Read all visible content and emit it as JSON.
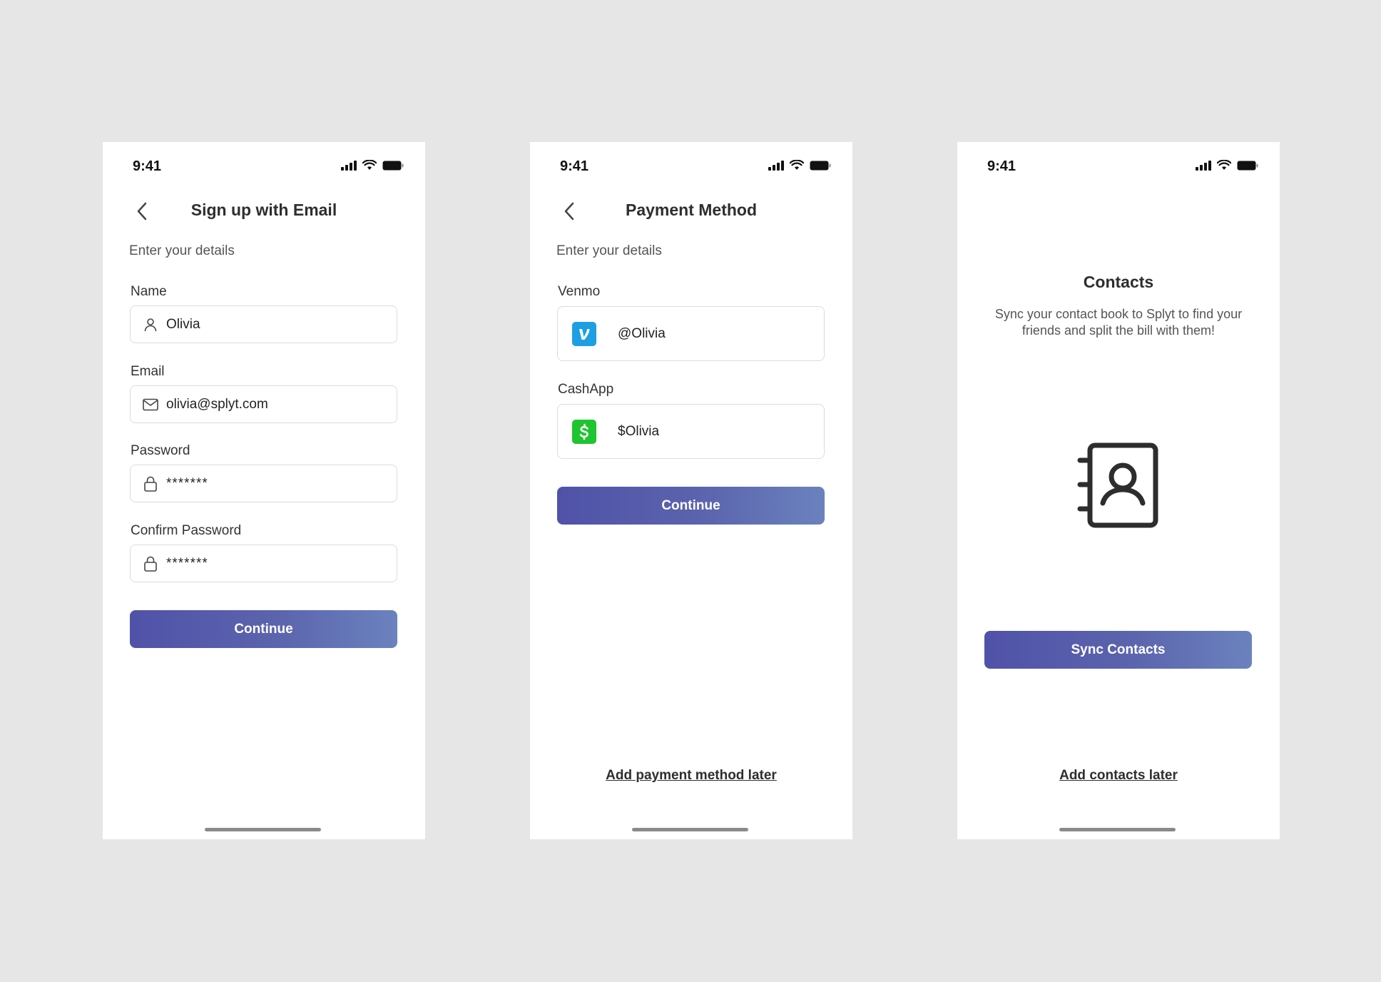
{
  "status_bar": {
    "time": "9:41"
  },
  "signup": {
    "title": "Sign up with Email",
    "subtitle": "Enter your details",
    "name_label": "Name",
    "name_value": "Olivia",
    "email_label": "Email",
    "email_value": "olivia@splyt.com",
    "password_label": "Password",
    "password_value": "*******",
    "confirm_label": "Confirm Password",
    "confirm_value": "*******",
    "continue_label": "Continue"
  },
  "payment": {
    "title": "Payment Method",
    "subtitle": "Enter your details",
    "venmo_label": "Venmo",
    "venmo_value": "@Olivia",
    "cashapp_label": "CashApp",
    "cashapp_value": "$Olivia",
    "continue_label": "Continue",
    "later_link": "Add payment method later"
  },
  "contacts": {
    "title": "Contacts",
    "description": "Sync your contact book to Splyt to find your friends and split the bill with them!",
    "sync_label": "Sync Contacts",
    "later_link": "Add contacts later"
  },
  "colors": {
    "background": "#e6e6e6",
    "button_gradient_start": "#5052a8",
    "button_gradient_end": "#6b82be",
    "venmo": "#1e9fe3",
    "cashapp": "#1ec531"
  },
  "icons": {
    "status": [
      "signal-icon",
      "wifi-icon",
      "battery-icon"
    ],
    "back": "chevron-left-icon",
    "name_field": "user-icon",
    "email_field": "mail-icon",
    "password_field": "lock-icon",
    "venmo": "venmo-logo-icon",
    "cashapp": "cashapp-logo-icon",
    "contacts": "contact-book-icon"
  }
}
